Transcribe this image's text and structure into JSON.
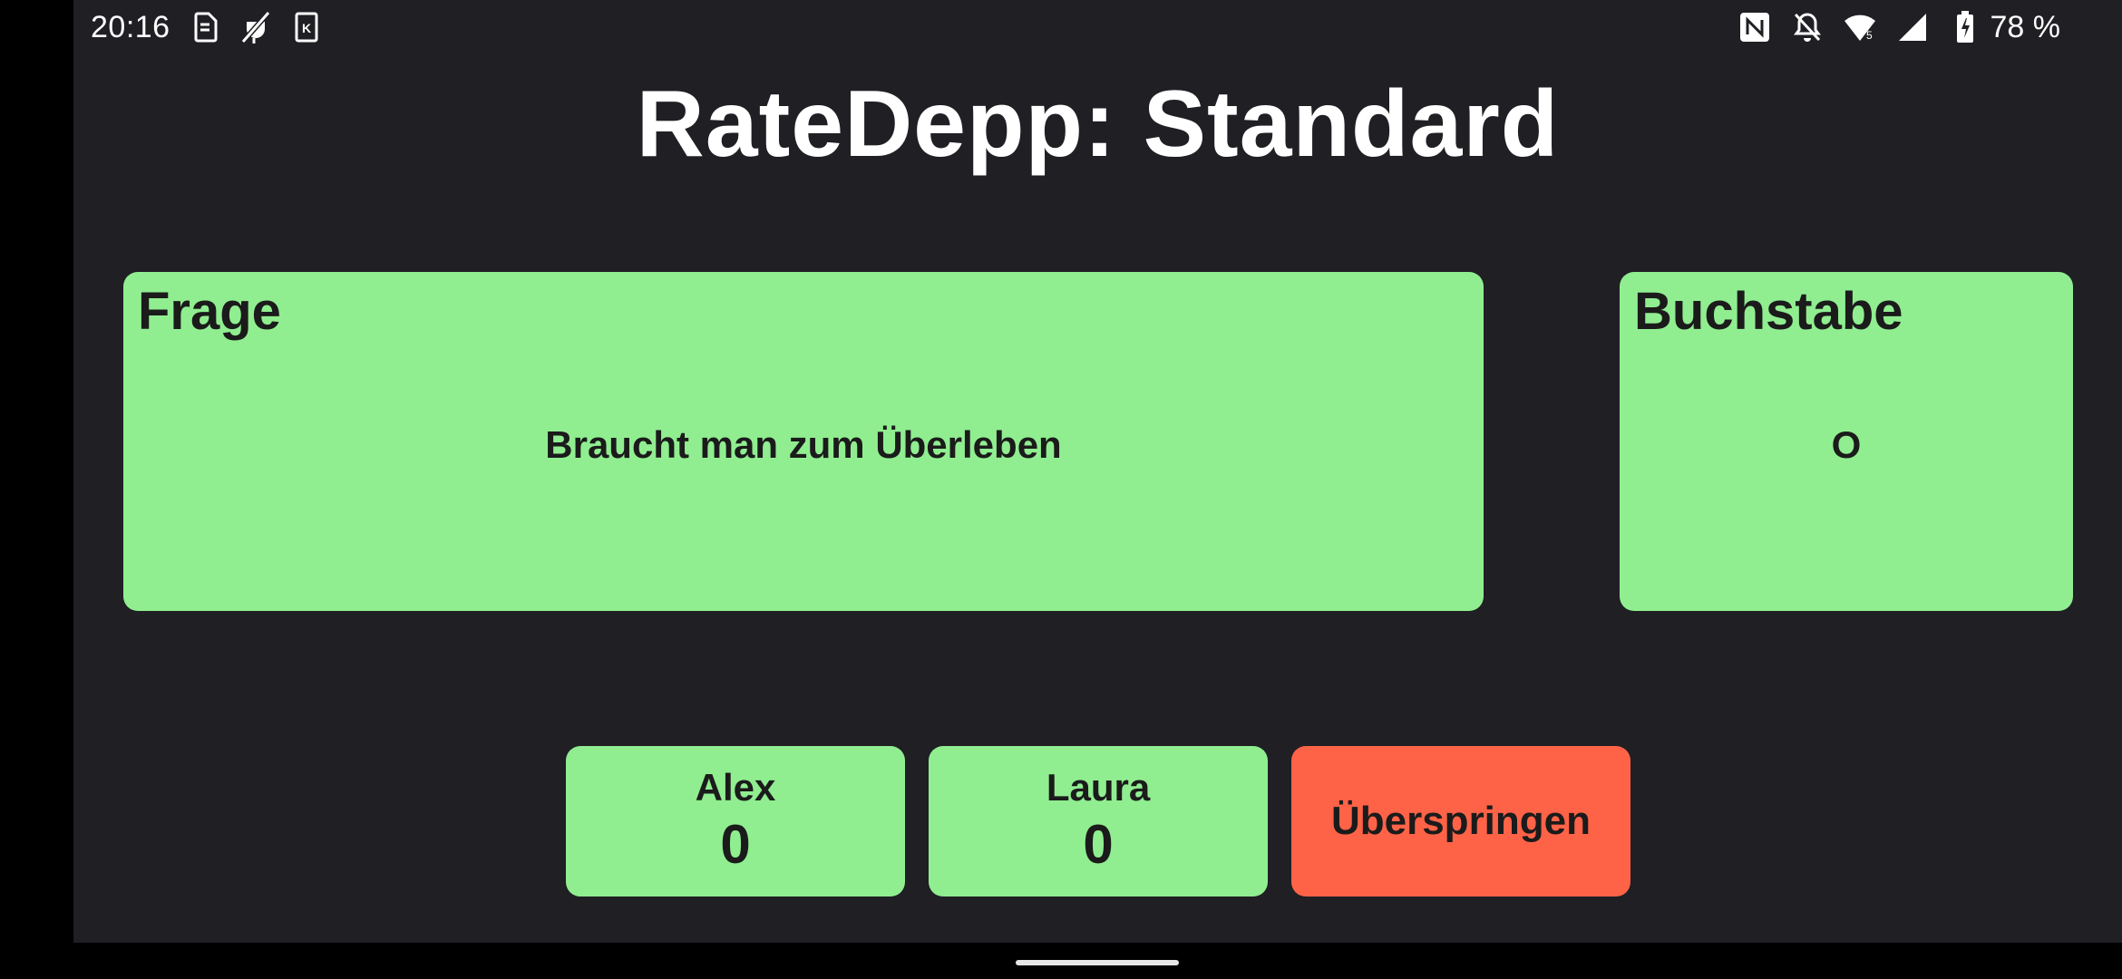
{
  "status_bar": {
    "time": "20:16",
    "left_icons": [
      "sd-card-icon",
      "no-charging-icon",
      "k-app-icon"
    ],
    "right_icons": [
      "nfc-icon",
      "bell-off-icon",
      "wifi-icon",
      "signal-icon",
      "battery-charging-icon"
    ],
    "battery": "78 %"
  },
  "title": "RateDepp: Standard",
  "question_card": {
    "label": "Frage",
    "value": "Braucht man zum Überleben"
  },
  "letter_card": {
    "label": "Buchstabe",
    "value": "O"
  },
  "players": [
    {
      "name": "Alex",
      "score": "0"
    },
    {
      "name": "Laura",
      "score": "0"
    }
  ],
  "skip_button": {
    "label": "Überspringen"
  },
  "colors": {
    "background": "#1f1f24",
    "card": "#90ee90",
    "skip": "#ff6347",
    "text_dark": "#1b1b1b",
    "text_light": "#ffffff"
  }
}
